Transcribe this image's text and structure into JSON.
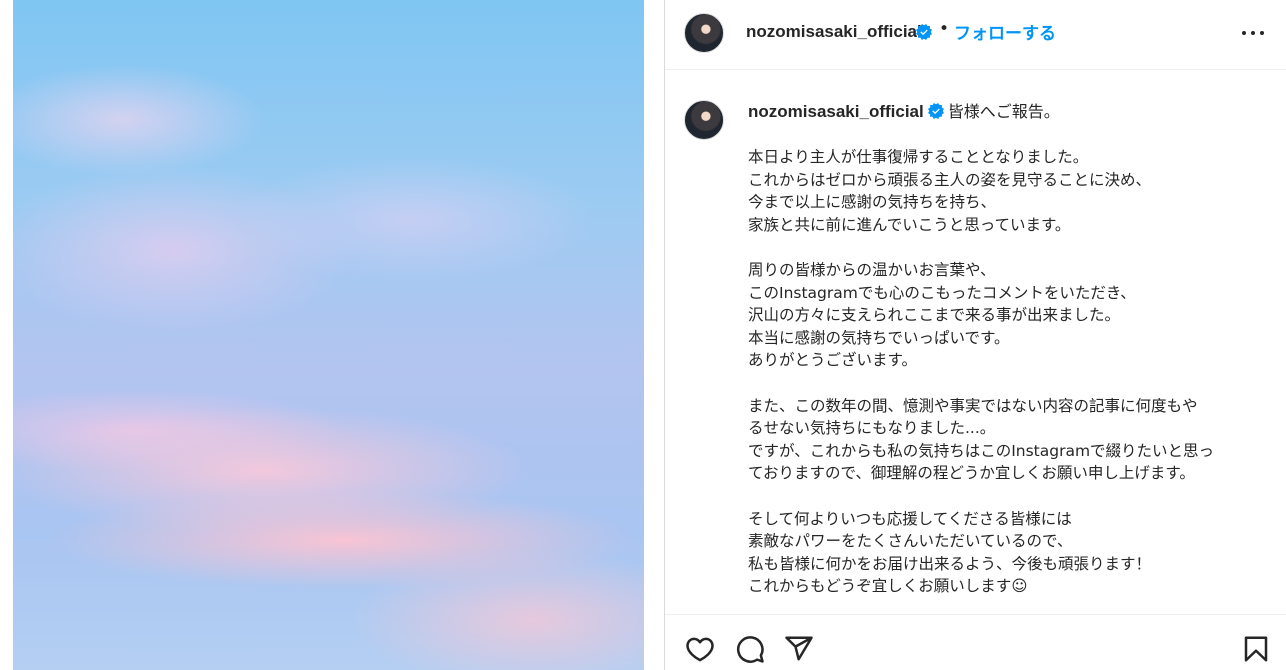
{
  "post": {
    "image_description_colors": {
      "sky_blue": "#7fc6f3",
      "sky_pink": "#fcc4d2",
      "sky_lavender": "#dccdf0"
    }
  },
  "header": {
    "username": "nozomisasaki_official",
    "separator": "•",
    "follow_label": "フォローする",
    "verified_icon": "verified-badge-icon",
    "more_icon": "more-options-icon"
  },
  "caption": {
    "username": "nozomisasaki_official",
    "first_line": "皆様へご報告。",
    "body": "本日より主人が仕事復帰することとなりました。\nこれからはゼロから頑張る主人の姿を見守ることに決め、\n今まで以上に感謝の気持ちを持ち、\n家族と共に前に進んでいこうと思っています。\n\n周りの皆様からの温かいお言葉や、\nこのInstagramでも心のこもったコメントをいただき、\n沢山の方々に支えられここまで来る事が出来ました。\n本当に感謝の気持ちでいっぱいです。\nありがとうございます。\n\nまた、この数年の間、憶測や事実ではない内容の記事に何度もや\nるせない気持ちにもなりました...。\nですが、これからも私の気持ちはこのInstagramで綴りたいと思っ\nておりますので、御理解の程どうか宜しくお願い申し上げます。\n\nそして何よりいつも応援してくださる皆様には\n素敵なパワーをたくさんいただいているので、\n私も皆様に何かをお届け出来るよう、今後も頑張ります！\nこれからもどうぞ宜しくお願いします☺"
  },
  "actions": {
    "icons": [
      "heart-icon",
      "comment-icon",
      "share-icon",
      "save-icon"
    ]
  },
  "colors": {
    "accent": "#0095f6",
    "text": "#262626",
    "border": "#dbdbdb"
  }
}
